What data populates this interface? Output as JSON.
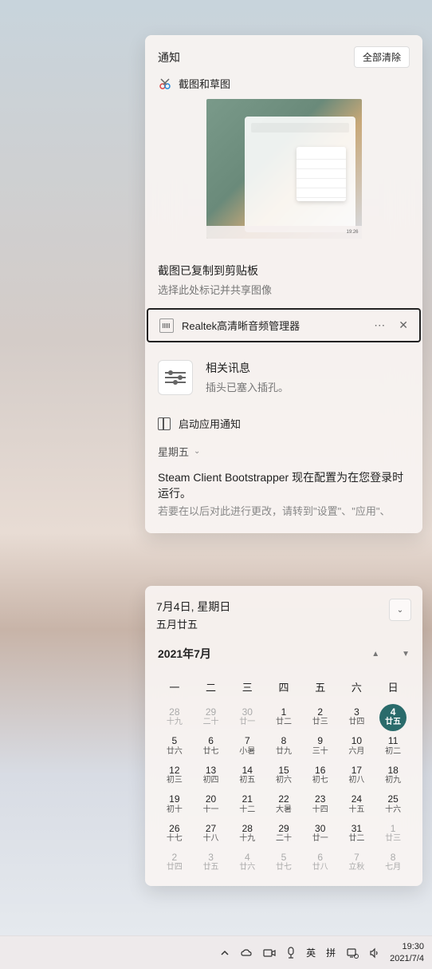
{
  "notifications": {
    "title": "通知",
    "clear_all": "全部清除",
    "snip": {
      "app_name": "截图和草图",
      "body_title": "截图已复制到剪贴板",
      "body_sub": "选择此处标记并共享图像"
    },
    "realtek": {
      "app_name": "Realtek高清晰音频管理器",
      "info_title": "相关讯息",
      "info_body": "插头已塞入插孔。",
      "launch_label": "启动应用通知"
    },
    "friday_label": "星期五",
    "steam": {
      "line1": "Steam Client Bootstrapper 现在配置为在您登录时运行。",
      "line2": "若要在以后对此进行更改，请转到\"设置\"、\"应用\"、"
    }
  },
  "calendar": {
    "date_main": "7月4日, 星期日",
    "date_sub": "五月廿五",
    "month_label": "2021年7月",
    "dow": [
      "一",
      "二",
      "三",
      "四",
      "五",
      "六",
      "日"
    ],
    "cells": [
      {
        "d": "28",
        "l": "十九",
        "dim": true
      },
      {
        "d": "29",
        "l": "二十",
        "dim": true
      },
      {
        "d": "30",
        "l": "廿一",
        "dim": true
      },
      {
        "d": "1",
        "l": "廿二"
      },
      {
        "d": "2",
        "l": "廿三"
      },
      {
        "d": "3",
        "l": "廿四"
      },
      {
        "d": "4",
        "l": "廿五",
        "today": true
      },
      {
        "d": "5",
        "l": "廿六"
      },
      {
        "d": "6",
        "l": "廿七"
      },
      {
        "d": "7",
        "l": "小暑"
      },
      {
        "d": "8",
        "l": "廿九"
      },
      {
        "d": "9",
        "l": "三十"
      },
      {
        "d": "10",
        "l": "六月"
      },
      {
        "d": "11",
        "l": "初二"
      },
      {
        "d": "12",
        "l": "初三"
      },
      {
        "d": "13",
        "l": "初四"
      },
      {
        "d": "14",
        "l": "初五"
      },
      {
        "d": "15",
        "l": "初六"
      },
      {
        "d": "16",
        "l": "初七"
      },
      {
        "d": "17",
        "l": "初八"
      },
      {
        "d": "18",
        "l": "初九"
      },
      {
        "d": "19",
        "l": "初十"
      },
      {
        "d": "20",
        "l": "十一"
      },
      {
        "d": "21",
        "l": "十二"
      },
      {
        "d": "22",
        "l": "大暑"
      },
      {
        "d": "23",
        "l": "十四"
      },
      {
        "d": "24",
        "l": "十五"
      },
      {
        "d": "25",
        "l": "十六"
      },
      {
        "d": "26",
        "l": "十七"
      },
      {
        "d": "27",
        "l": "十八"
      },
      {
        "d": "28",
        "l": "十九"
      },
      {
        "d": "29",
        "l": "二十"
      },
      {
        "d": "30",
        "l": "廿一"
      },
      {
        "d": "31",
        "l": "廿二"
      },
      {
        "d": "1",
        "l": "廿三",
        "dim": true
      },
      {
        "d": "2",
        "l": "廿四",
        "dim": true
      },
      {
        "d": "3",
        "l": "廿五",
        "dim": true
      },
      {
        "d": "4",
        "l": "廿六",
        "dim": true
      },
      {
        "d": "5",
        "l": "廿七",
        "dim": true
      },
      {
        "d": "6",
        "l": "廿八",
        "dim": true
      },
      {
        "d": "7",
        "l": "立秋",
        "dim": true
      },
      {
        "d": "8",
        "l": "七月",
        "dim": true
      }
    ]
  },
  "taskbar": {
    "ime_lang": "英",
    "ime_mode": "拼",
    "time": "19:30",
    "date": "2021/7/4"
  }
}
